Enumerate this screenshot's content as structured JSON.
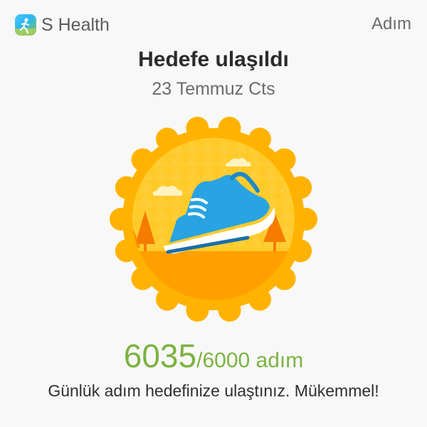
{
  "header": {
    "app_name": "S Health",
    "right_label": "Adım"
  },
  "main": {
    "title": "Hedefe ulaşıldı",
    "date": "23 Temmuz Cts",
    "badge_icon": "running-shoe-icon",
    "steps": {
      "current": "6035",
      "goal": "/6000",
      "unit": " adım"
    },
    "message": "Günlük adım hedefinize ulaştınız. Mükemmel!"
  },
  "colors": {
    "accent_green": "#7cb342",
    "badge_orange": "#ffb300",
    "shoe_blue": "#29a3e1"
  }
}
